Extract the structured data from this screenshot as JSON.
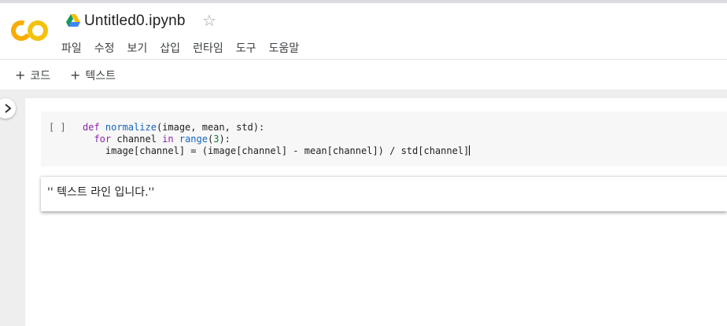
{
  "document": {
    "title": "Untitled0.ipynb",
    "logo_text": "CO"
  },
  "menu": [
    "파일",
    "수정",
    "보기",
    "삽입",
    "런타임",
    "도구",
    "도움말"
  ],
  "toolbar": {
    "add_code_label": "코드",
    "add_text_label": "텍스트",
    "plus": "+"
  },
  "code_cell": {
    "run_label": "[ ]",
    "lines": [
      [
        {
          "t": "kw",
          "v": "def "
        },
        {
          "t": "fn",
          "v": "normalize"
        },
        {
          "t": "",
          "v": "(image, mean, std):"
        }
      ],
      [
        {
          "t": "",
          "v": "  "
        },
        {
          "t": "kw",
          "v": "for"
        },
        {
          "t": "",
          "v": " channel "
        },
        {
          "t": "kw",
          "v": "in"
        },
        {
          "t": "",
          "v": " "
        },
        {
          "t": "fn",
          "v": "range"
        },
        {
          "t": "",
          "v": "("
        },
        {
          "t": "num",
          "v": "3"
        },
        {
          "t": "",
          "v": "):"
        }
      ],
      [
        {
          "t": "",
          "v": "    image[channel] = (image[channel] - mean[channel]) / std[channel]"
        }
      ]
    ]
  },
  "text_cell": {
    "content": "'' 텍스트 라인 입니다.''"
  },
  "colors": {
    "keyword": "#8e24aa",
    "function": "#1565c0",
    "number": "#0b7a2d",
    "logo_orange": "#f9ab00",
    "logo_yellow": "#f4c20d"
  },
  "icons": {
    "logo": "colab-logo",
    "drive": "google-drive-icon",
    "star": "star-outline-icon",
    "toggle": "chevron-right-icon"
  }
}
